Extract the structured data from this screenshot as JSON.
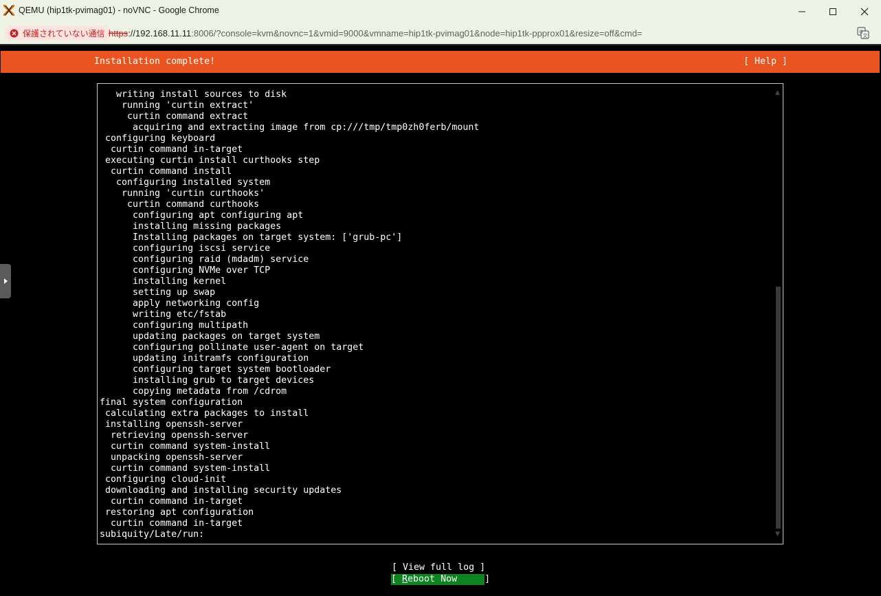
{
  "window": {
    "title": "QEMU (hip1tk-pvimag01) - noVNC - Google Chrome",
    "controls": [
      "minimize",
      "maximize",
      "close"
    ]
  },
  "address_bar": {
    "security_label": "保護されていない通信",
    "url_scheme": "https",
    "url_host": "://192.168.11.11",
    "url_rest": ":8006/?console=kvm&novnc=1&vmid=9000&vmname=hip1tk-pvimag01&node=hip1tk-ppprox01&resize=off&cmd=",
    "security_color": "#c5221f"
  },
  "installer": {
    "header_title": "Installation complete!",
    "help_label": "[ Help ]",
    "accent_color": "#e95420",
    "log_lines": [
      "   writing install sources to disk",
      "    running 'curtin extract'",
      "     curtin command extract",
      "      acquiring and extracting image from cp:///tmp/tmp0zh0ferb/mount",
      " configuring keyboard",
      "  curtin command in-target",
      " executing curtin install curthooks step",
      "  curtin command install",
      "   configuring installed system",
      "    running 'curtin curthooks'",
      "     curtin command curthooks",
      "      configuring apt configuring apt",
      "      installing missing packages",
      "      Installing packages on target system: ['grub-pc']",
      "      configuring iscsi service",
      "      configuring raid (mdadm) service",
      "      configuring NVMe over TCP",
      "      installing kernel",
      "      setting up swap",
      "      apply networking config",
      "      writing etc/fstab",
      "      configuring multipath",
      "      updating packages on target system",
      "      configuring pollinate user-agent on target",
      "      updating initramfs configuration",
      "      configuring target system bootloader",
      "      installing grub to target devices",
      "      copying metadata from /cdrom",
      "final system configuration",
      " calculating extra packages to install",
      " installing openssh-server",
      "  retrieving openssh-server",
      "  curtin command system-install",
      "  unpacking openssh-server",
      "  curtin command system-install",
      " configuring cloud-init",
      " downloading and installing security updates",
      "  curtin command in-target",
      " restoring apt configuration",
      "  curtin command in-target",
      "subiquity/Late/run:"
    ],
    "view_log_label": "[ View full log ]",
    "reboot_open": "[ ",
    "reboot_hotkey": "R",
    "reboot_rest": "eboot Now     ]",
    "reboot_color": "#0e8420"
  }
}
